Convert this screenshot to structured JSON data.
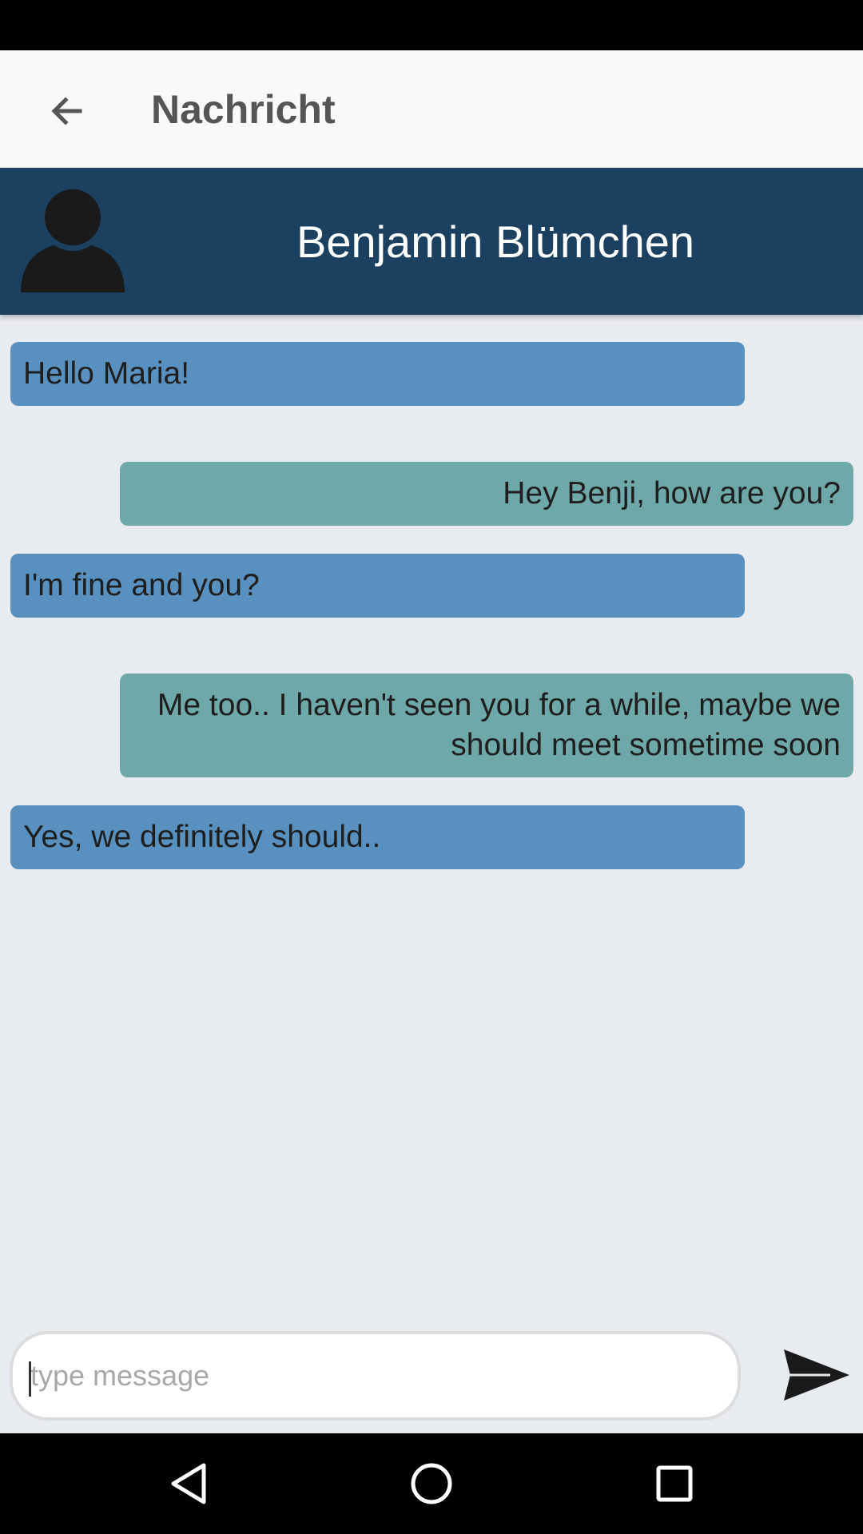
{
  "app_bar": {
    "title": "Nachricht",
    "back_icon": "arrow-left-icon"
  },
  "contact": {
    "name": "Benjamin Blümchen",
    "avatar_icon": "person-silhouette-icon"
  },
  "messages": [
    {
      "direction": "incoming",
      "text": "Hello Maria!"
    },
    {
      "direction": "outgoing",
      "text": "Hey Benji, how are you?"
    },
    {
      "direction": "incoming",
      "text": "I'm fine and you?"
    },
    {
      "direction": "outgoing",
      "text": "Me too.. I haven't seen you for a while, maybe we should meet sometime soon"
    },
    {
      "direction": "incoming",
      "text": "Yes, we definitely should.."
    }
  ],
  "compose": {
    "placeholder": "type message",
    "value": "",
    "send_icon": "send-icon"
  },
  "nav_bar": {
    "back_icon": "nav-back-icon",
    "home_icon": "nav-home-icon",
    "recents_icon": "nav-recents-icon"
  },
  "colors": {
    "header_bg": "#1b4060",
    "incoming_bubble": "#5890bf",
    "outgoing_bubble": "#6fa8a8",
    "chat_bg": "#e8ebf0",
    "app_bar_bg": "#f9f9f9"
  }
}
